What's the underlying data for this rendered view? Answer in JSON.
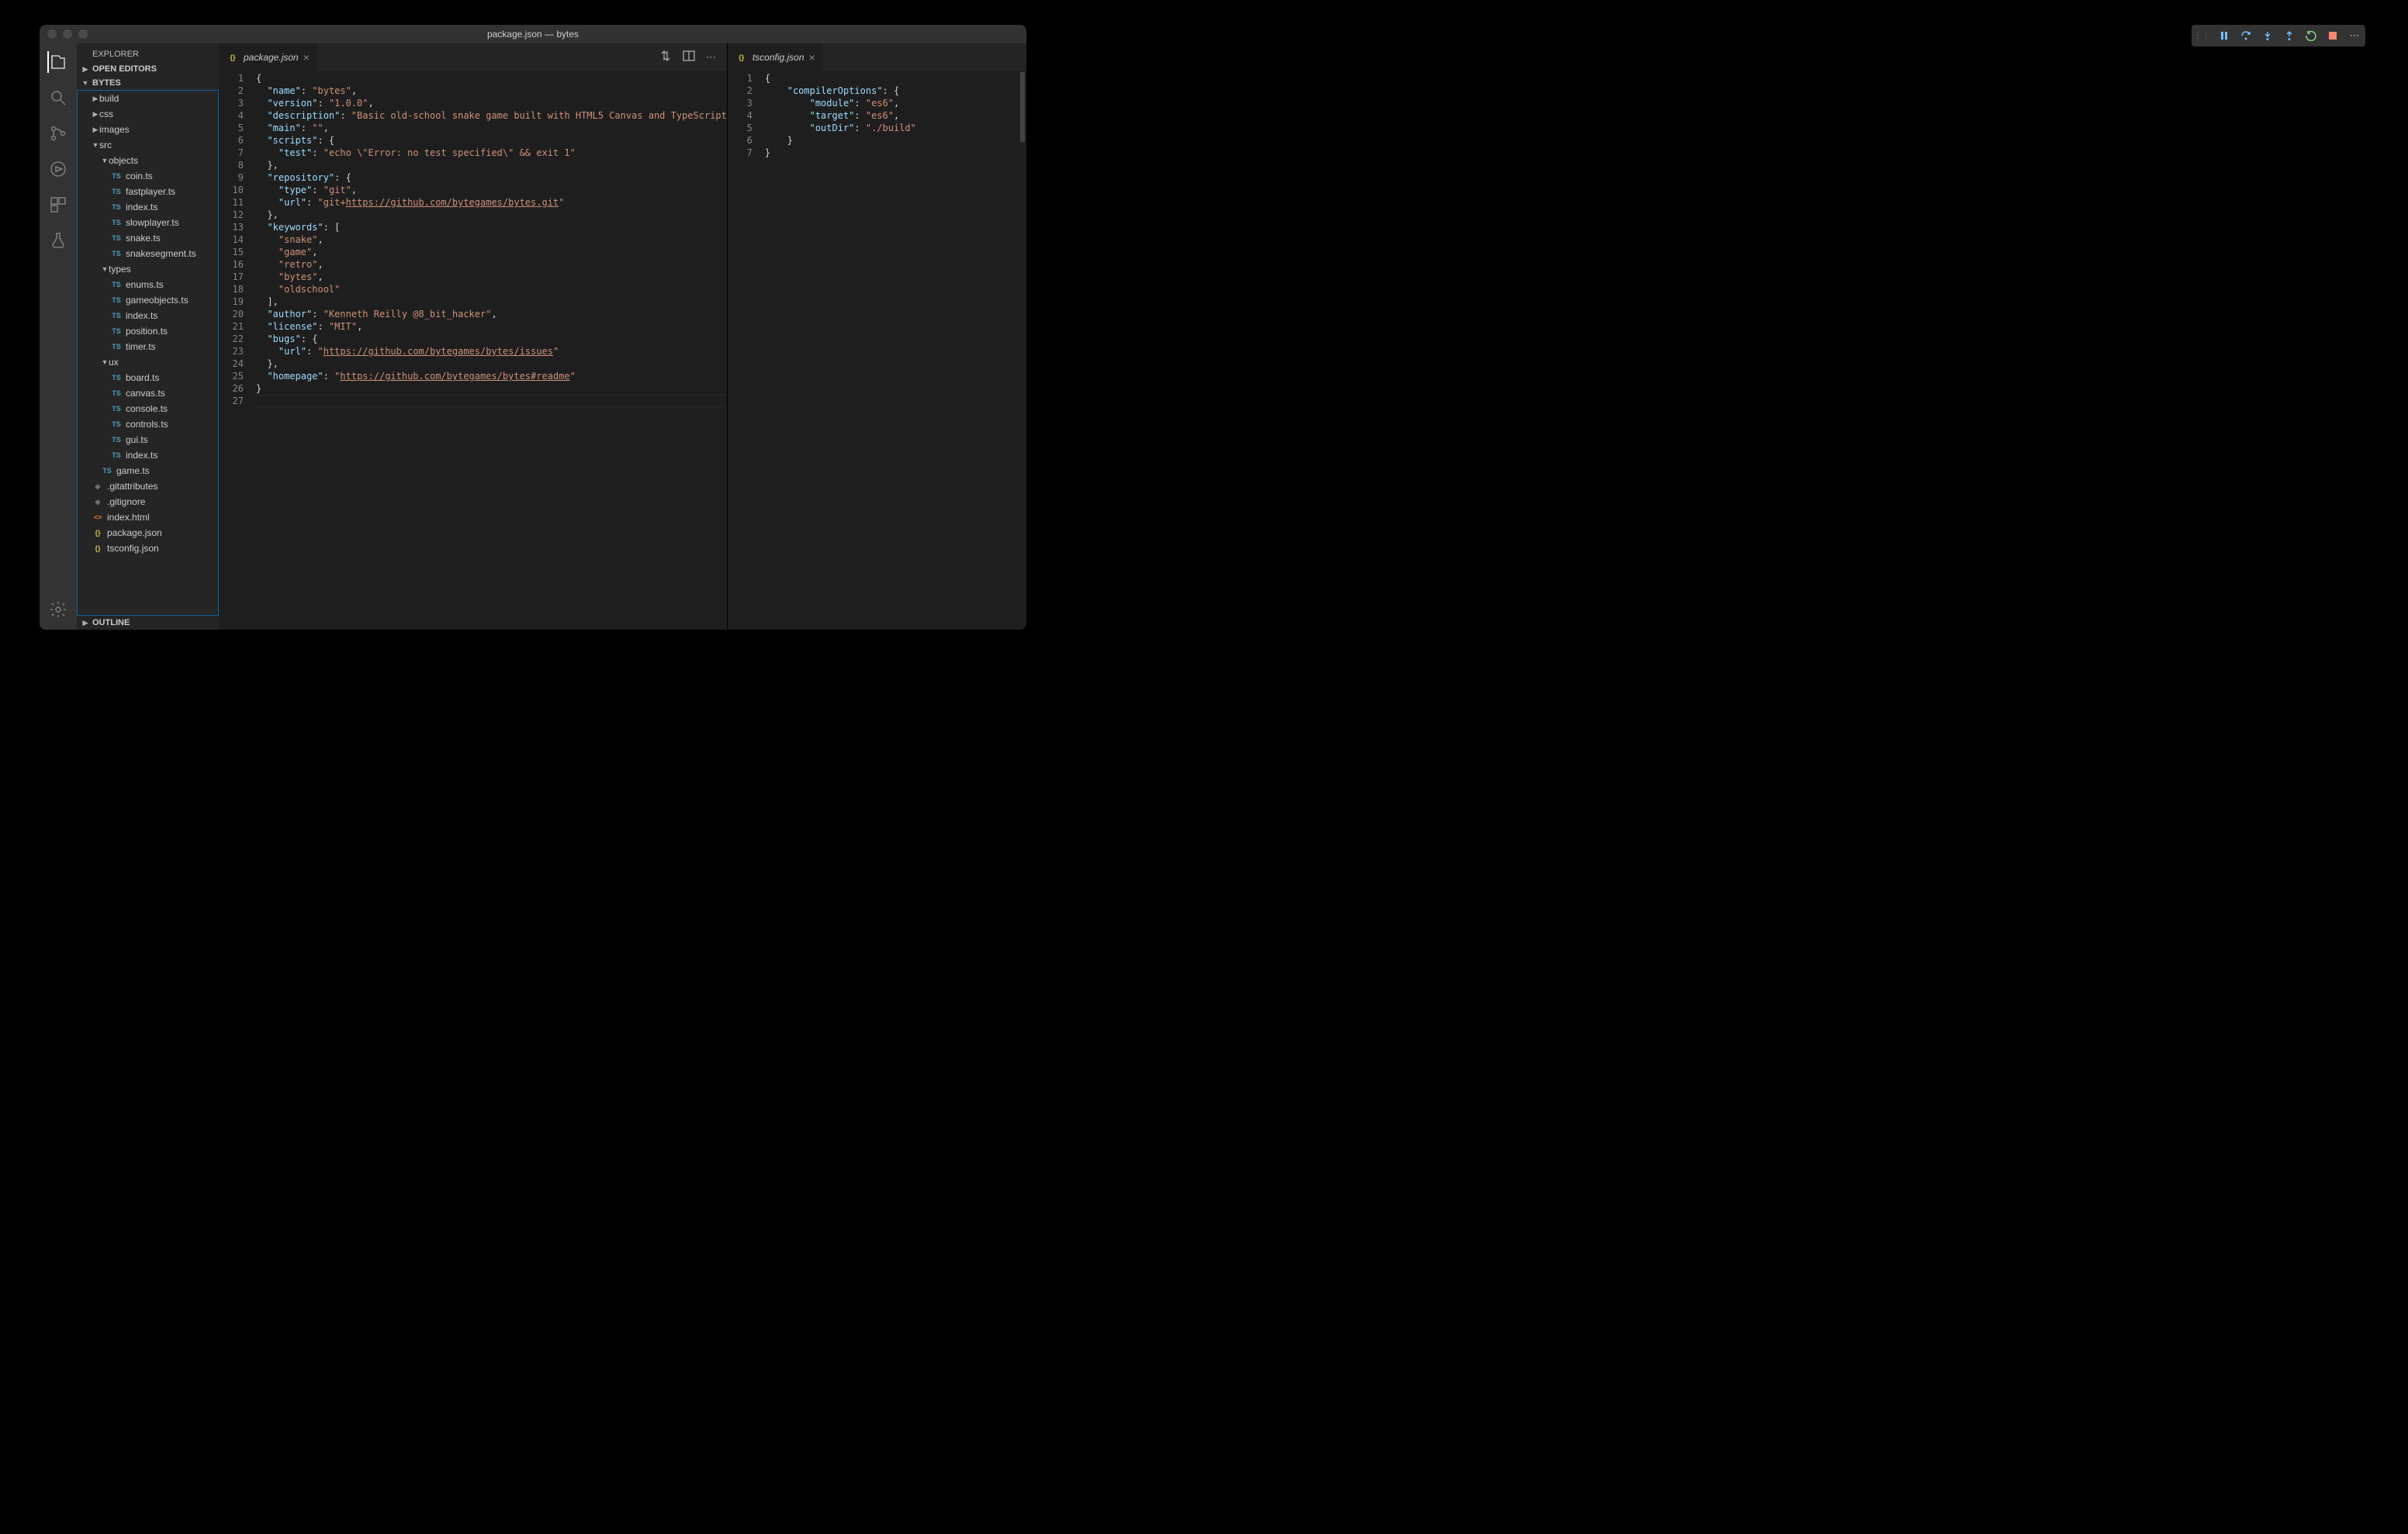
{
  "window_title": "package.json — bytes",
  "sidebar": {
    "title": "EXPLORER",
    "sections": {
      "open_editors": "OPEN EDITORS",
      "project": "BYTES",
      "outline": "OUTLINE"
    }
  },
  "tree": [
    {
      "depth": 1,
      "type": "folder",
      "open": false,
      "label": "build"
    },
    {
      "depth": 1,
      "type": "folder",
      "open": false,
      "label": "css"
    },
    {
      "depth": 1,
      "type": "folder",
      "open": false,
      "label": "images"
    },
    {
      "depth": 1,
      "type": "folder",
      "open": true,
      "label": "src"
    },
    {
      "depth": 2,
      "type": "folder",
      "open": true,
      "label": "objects"
    },
    {
      "depth": 3,
      "type": "ts",
      "label": "coin.ts"
    },
    {
      "depth": 3,
      "type": "ts",
      "label": "fastplayer.ts"
    },
    {
      "depth": 3,
      "type": "ts",
      "label": "index.ts"
    },
    {
      "depth": 3,
      "type": "ts",
      "label": "slowplayer.ts"
    },
    {
      "depth": 3,
      "type": "ts",
      "label": "snake.ts"
    },
    {
      "depth": 3,
      "type": "ts",
      "label": "snakesegment.ts"
    },
    {
      "depth": 2,
      "type": "folder",
      "open": true,
      "label": "types"
    },
    {
      "depth": 3,
      "type": "ts",
      "label": "enums.ts"
    },
    {
      "depth": 3,
      "type": "ts",
      "label": "gameobjects.ts"
    },
    {
      "depth": 3,
      "type": "ts",
      "label": "index.ts"
    },
    {
      "depth": 3,
      "type": "ts",
      "label": "position.ts"
    },
    {
      "depth": 3,
      "type": "ts",
      "label": "timer.ts"
    },
    {
      "depth": 2,
      "type": "folder",
      "open": true,
      "label": "ux"
    },
    {
      "depth": 3,
      "type": "ts",
      "label": "board.ts"
    },
    {
      "depth": 3,
      "type": "ts",
      "label": "canvas.ts"
    },
    {
      "depth": 3,
      "type": "ts",
      "label": "console.ts"
    },
    {
      "depth": 3,
      "type": "ts",
      "label": "controls.ts"
    },
    {
      "depth": 3,
      "type": "ts",
      "label": "gui.ts"
    },
    {
      "depth": 3,
      "type": "ts",
      "label": "index.ts"
    },
    {
      "depth": 2,
      "type": "ts",
      "label": "game.ts"
    },
    {
      "depth": 1,
      "type": "git",
      "label": ".gitattributes"
    },
    {
      "depth": 1,
      "type": "git",
      "label": ".gitignore"
    },
    {
      "depth": 1,
      "type": "html",
      "label": "index.html"
    },
    {
      "depth": 1,
      "type": "json",
      "label": "package.json"
    },
    {
      "depth": 1,
      "type": "json",
      "label": "tsconfig.json"
    }
  ],
  "editors": {
    "left": {
      "tab_label": "package.json",
      "lines": [
        [
          [
            "pun",
            "{"
          ]
        ],
        [
          [
            "pun",
            "  "
          ],
          [
            "key",
            "\"name\""
          ],
          [
            "pun",
            ": "
          ],
          [
            "str",
            "\"bytes\""
          ],
          [
            "pun",
            ","
          ]
        ],
        [
          [
            "pun",
            "  "
          ],
          [
            "key",
            "\"version\""
          ],
          [
            "pun",
            ": "
          ],
          [
            "str",
            "\"1.0.0\""
          ],
          [
            "pun",
            ","
          ]
        ],
        [
          [
            "pun",
            "  "
          ],
          [
            "key",
            "\"description\""
          ],
          [
            "pun",
            ": "
          ],
          [
            "str",
            "\"Basic old-school snake game built with HTML5 Canvas and TypeScript\""
          ],
          [
            "pun",
            ","
          ]
        ],
        [
          [
            "pun",
            "  "
          ],
          [
            "key",
            "\"main\""
          ],
          [
            "pun",
            ": "
          ],
          [
            "str",
            "\"\""
          ],
          [
            "pun",
            ","
          ]
        ],
        [
          [
            "pun",
            "  "
          ],
          [
            "key",
            "\"scripts\""
          ],
          [
            "pun",
            ": {"
          ]
        ],
        [
          [
            "pun",
            "    "
          ],
          [
            "key",
            "\"test\""
          ],
          [
            "pun",
            ": "
          ],
          [
            "str",
            "\"echo \\\"Error: no test specified\\\" && exit 1\""
          ]
        ],
        [
          [
            "pun",
            "  },"
          ]
        ],
        [
          [
            "pun",
            "  "
          ],
          [
            "key",
            "\"repository\""
          ],
          [
            "pun",
            ": {"
          ]
        ],
        [
          [
            "pun",
            "    "
          ],
          [
            "key",
            "\"type\""
          ],
          [
            "pun",
            ": "
          ],
          [
            "str",
            "\"git\""
          ],
          [
            "pun",
            ","
          ]
        ],
        [
          [
            "pun",
            "    "
          ],
          [
            "key",
            "\"url\""
          ],
          [
            "pun",
            ": "
          ],
          [
            "str",
            "\"git+"
          ],
          [
            "url",
            "https://github.com/bytegames/bytes.git"
          ],
          [
            "str",
            "\""
          ]
        ],
        [
          [
            "pun",
            "  },"
          ]
        ],
        [
          [
            "pun",
            "  "
          ],
          [
            "key",
            "\"keywords\""
          ],
          [
            "pun",
            ": ["
          ]
        ],
        [
          [
            "pun",
            "    "
          ],
          [
            "str",
            "\"snake\""
          ],
          [
            "pun",
            ","
          ]
        ],
        [
          [
            "pun",
            "    "
          ],
          [
            "str",
            "\"game\""
          ],
          [
            "pun",
            ","
          ]
        ],
        [
          [
            "pun",
            "    "
          ],
          [
            "str",
            "\"retro\""
          ],
          [
            "pun",
            ","
          ]
        ],
        [
          [
            "pun",
            "    "
          ],
          [
            "str",
            "\"bytes\""
          ],
          [
            "pun",
            ","
          ]
        ],
        [
          [
            "pun",
            "    "
          ],
          [
            "str",
            "\"oldschool\""
          ]
        ],
        [
          [
            "pun",
            "  ],"
          ]
        ],
        [
          [
            "pun",
            "  "
          ],
          [
            "key",
            "\"author\""
          ],
          [
            "pun",
            ": "
          ],
          [
            "str",
            "\"Kenneth Reilly @8_bit_hacker\""
          ],
          [
            "pun",
            ","
          ]
        ],
        [
          [
            "pun",
            "  "
          ],
          [
            "key",
            "\"license\""
          ],
          [
            "pun",
            ": "
          ],
          [
            "str",
            "\"MIT\""
          ],
          [
            "pun",
            ","
          ]
        ],
        [
          [
            "pun",
            "  "
          ],
          [
            "key",
            "\"bugs\""
          ],
          [
            "pun",
            ": {"
          ]
        ],
        [
          [
            "pun",
            "    "
          ],
          [
            "key",
            "\"url\""
          ],
          [
            "pun",
            ": "
          ],
          [
            "str",
            "\""
          ],
          [
            "url",
            "https://github.com/bytegames/bytes/issues"
          ],
          [
            "str",
            "\""
          ]
        ],
        [
          [
            "pun",
            "  },"
          ]
        ],
        [
          [
            "pun",
            "  "
          ],
          [
            "key",
            "\"homepage\""
          ],
          [
            "pun",
            ": "
          ],
          [
            "str",
            "\""
          ],
          [
            "url",
            "https://github.com/bytegames/bytes#readme"
          ],
          [
            "str",
            "\""
          ]
        ],
        [
          [
            "pun",
            "}"
          ]
        ],
        [
          [
            "pun",
            ""
          ]
        ]
      ]
    },
    "right": {
      "tab_label": "tsconfig.json",
      "lines": [
        [
          [
            "pun",
            "{"
          ]
        ],
        [
          [
            "pun",
            "    "
          ],
          [
            "key",
            "\"compilerOptions\""
          ],
          [
            "pun",
            ": {"
          ]
        ],
        [
          [
            "pun",
            "        "
          ],
          [
            "key",
            "\"module\""
          ],
          [
            "pun",
            ": "
          ],
          [
            "str",
            "\"es6\""
          ],
          [
            "pun",
            ","
          ]
        ],
        [
          [
            "pun",
            "        "
          ],
          [
            "key",
            "\"target\""
          ],
          [
            "pun",
            ": "
          ],
          [
            "str",
            "\"es6\""
          ],
          [
            "pun",
            ","
          ]
        ],
        [
          [
            "pun",
            "        "
          ],
          [
            "key",
            "\"outDir\""
          ],
          [
            "pun",
            ": "
          ],
          [
            "str",
            "\"./build\""
          ]
        ],
        [
          [
            "pun",
            "    }"
          ]
        ],
        [
          [
            "pun",
            "}"
          ]
        ]
      ]
    }
  }
}
